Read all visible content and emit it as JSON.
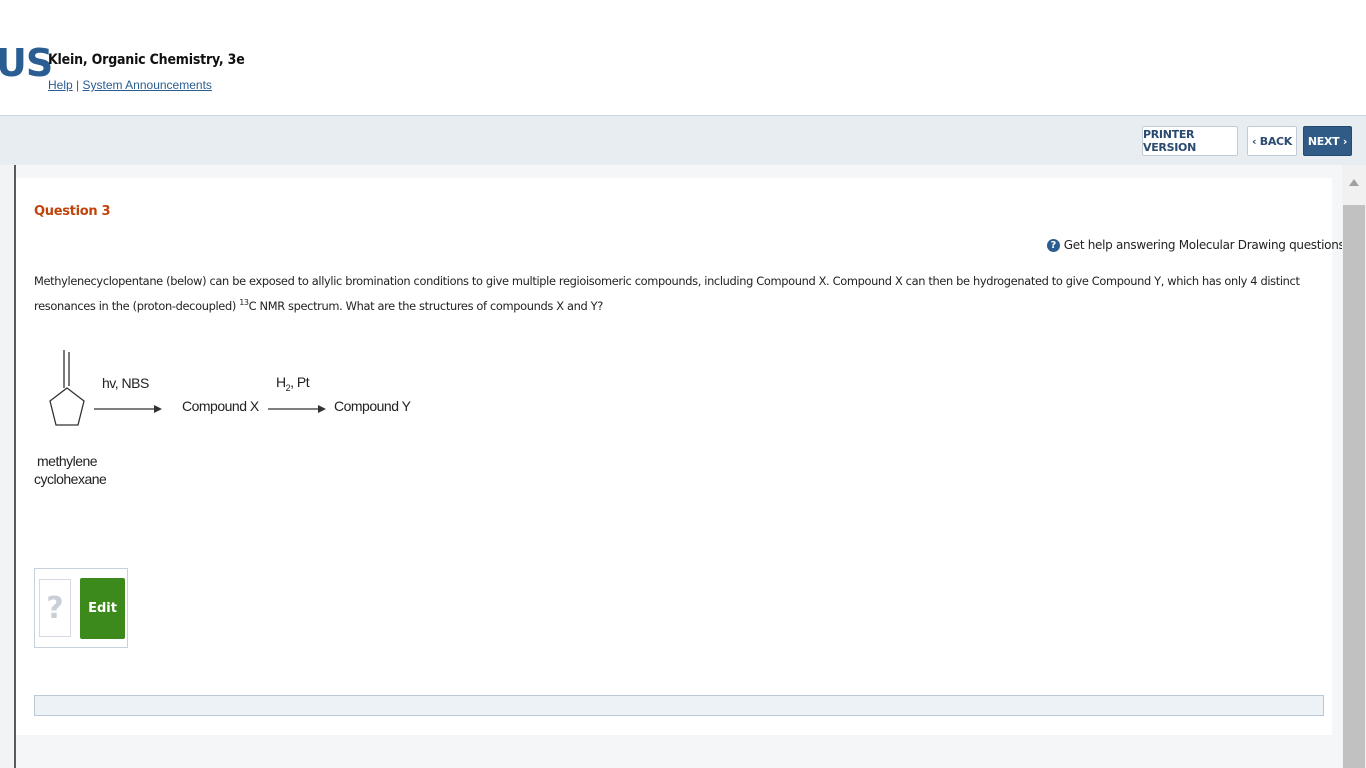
{
  "header": {
    "logo_text": "US",
    "course_title": "Klein, Organic Chemistry, 3e",
    "help_link": "Help",
    "separator": "|",
    "announcements_link": "System Announcements"
  },
  "toolbar": {
    "printer_label": "PRINTER VERSION",
    "back_label": "‹ BACK",
    "next_label": "NEXT ›"
  },
  "question": {
    "title": "Question 3",
    "help_text": "Get help answering Molecular Drawing questions.",
    "text_part1": "Methylenecyclopentane (below) can be exposed to allylic bromination conditions to give multiple regioisomeric compounds, including Compound X. Compound X can then be hydrogenated to give Compound Y, which has only 4 distinct resonances in the (proton-decoupled) ",
    "superscript": "13",
    "text_part2": "C NMR spectrum. What are the structures of compounds X and Y?"
  },
  "diagram": {
    "reagent1": "hv, NBS",
    "compound_x": "Compound X",
    "reagent2_h": "H",
    "reagent2_sub": "2",
    "reagent2_rest": ", Pt",
    "compound_y": "Compound Y",
    "label_line1": "methylene",
    "label_line2": "cyclohexane"
  },
  "answer": {
    "placeholder_glyph": "?",
    "edit_label": "Edit"
  },
  "colors": {
    "accent": "#2a5d91",
    "question_title": "#c0440b",
    "edit_button": "#3d8a1c",
    "next_button": "#2f5b86"
  }
}
